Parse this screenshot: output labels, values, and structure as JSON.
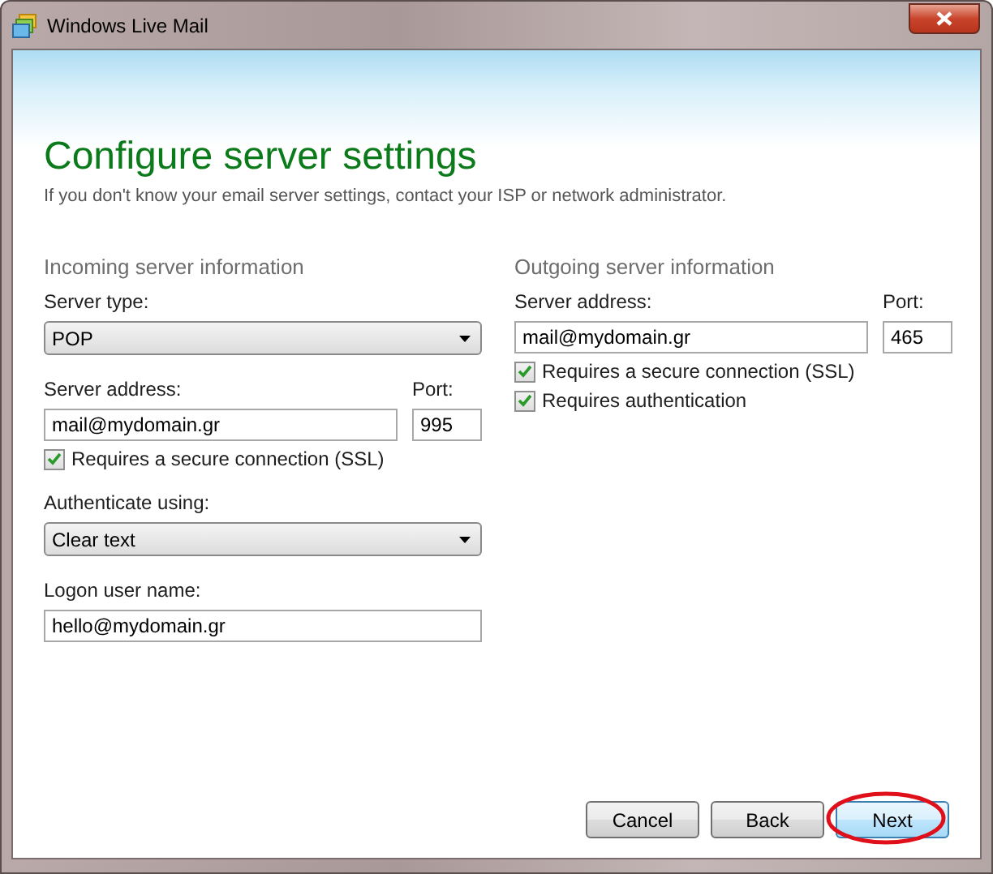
{
  "window": {
    "title": "Windows Live Mail"
  },
  "header": {
    "title": "Configure server settings",
    "subtitle": "If you don't know your email server settings, contact your ISP or network administrator."
  },
  "incoming": {
    "heading": "Incoming server information",
    "server_type": {
      "label": "Server type:",
      "value": "POP"
    },
    "server_address": {
      "label": "Server address:",
      "value": "mail@mydomain.gr"
    },
    "port": {
      "label": "Port:",
      "value": "995"
    },
    "checkboxes": [
      {
        "label": "Requires a secure connection (SSL)",
        "checked": true
      }
    ],
    "authenticate": {
      "label": "Authenticate using:",
      "value": "Clear text"
    },
    "logon": {
      "label": "Logon user name:",
      "value": "hello@mydomain.gr"
    }
  },
  "outgoing": {
    "heading": "Outgoing server information",
    "server_address": {
      "label": "Server address:",
      "value": "mail@mydomain.gr"
    },
    "port": {
      "label": "Port:",
      "value": "465"
    },
    "checkboxes": [
      {
        "label": "Requires a secure connection (SSL)",
        "checked": true
      },
      {
        "label": "Requires authentication",
        "checked": true
      }
    ]
  },
  "buttons": [
    {
      "label": "Cancel",
      "default": false,
      "circled": false
    },
    {
      "label": "Back",
      "default": false,
      "circled": false
    },
    {
      "label": "Next",
      "default": true,
      "circled": true
    }
  ]
}
